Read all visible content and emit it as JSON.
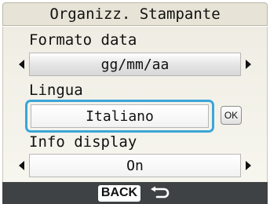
{
  "window": {
    "title": "Organizz. Stampante"
  },
  "settings": {
    "date_format": {
      "label": "Formato data",
      "value": "gg/mm/aa"
    },
    "language": {
      "label": "Lingua",
      "value": "Italiano",
      "ok_label": "OK"
    },
    "info_display": {
      "label": "Info display",
      "value": "On"
    }
  },
  "footer": {
    "back_label": "BACK",
    "back_icon": "return-arrow-icon"
  },
  "colors": {
    "focus": "#3aa6d8",
    "footer_bg": "#3f4244",
    "title_bg": "#e7e3d6"
  }
}
